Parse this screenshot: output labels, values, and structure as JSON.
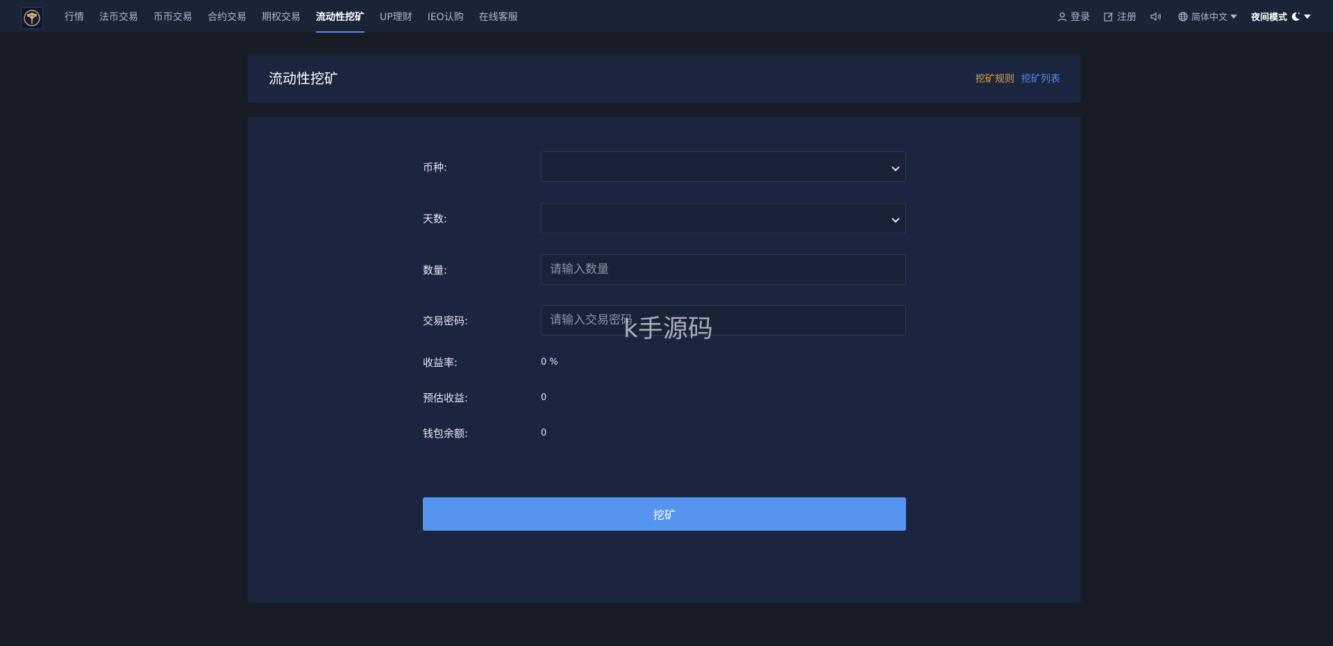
{
  "nav": {
    "items": [
      {
        "label": "行情"
      },
      {
        "label": "法币交易"
      },
      {
        "label": "币币交易"
      },
      {
        "label": "合约交易"
      },
      {
        "label": "期权交易"
      },
      {
        "label": "流动性挖矿",
        "active": true
      },
      {
        "label": "UP理财"
      },
      {
        "label": "IEO认购"
      },
      {
        "label": "在线客服"
      }
    ],
    "login_label": "登录",
    "register_label": "注册",
    "language_label": "简体中文",
    "night_mode_label": "夜间模式"
  },
  "header": {
    "title": "流动性挖矿",
    "rules_link": "挖矿规则",
    "list_link": "挖矿列表"
  },
  "form": {
    "currency_label": "币种:",
    "currency_value": "",
    "days_label": "天数:",
    "days_value": "",
    "amount_label": "数量:",
    "amount_placeholder": "请输入数量",
    "password_label": "交易密码:",
    "password_placeholder": "请输入交易密码",
    "yield_label": "收益率:",
    "yield_value": "0 %",
    "estimated_label": "预估收益:",
    "estimated_value": "0",
    "balance_label": "钱包余额:",
    "balance_value": "0",
    "submit_label": "挖矿"
  },
  "watermark": "k手源码",
  "colors": {
    "accent": "#4d8ef5",
    "button": "#5595f0",
    "rules_link": "#e6a23c",
    "page_bg": "#171c27",
    "card_bg": "#1b2540"
  }
}
